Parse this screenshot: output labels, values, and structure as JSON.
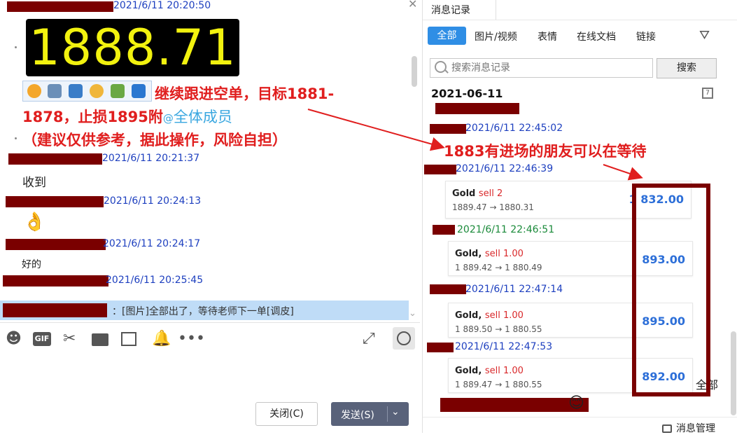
{
  "left": {
    "messages": [
      {
        "time": "2021/6/11 20:20:50"
      },
      {
        "time": "2021/6/11 20:21:37",
        "text": "收到"
      },
      {
        "time": "2021/6/11 20:24:13",
        "emoji": "👌"
      },
      {
        "time": "2021/6/11 20:24:17",
        "text": "好的"
      },
      {
        "time": "2021/6/11 20:25:45"
      }
    ],
    "price_display": "1888.71",
    "annotation_line1": "继续跟进空单，目标1881-",
    "annotation_line2": "1878，止损1895附",
    "mention_at": "@",
    "mention": "全体成员",
    "annotation_line3": "（建议仅供参考，据此操作，风险自担）",
    "notice_text": "：[图片]全部出了，等待老师下一单[调皮]",
    "close_button": "关闭(C)",
    "send_button": "发送(S)"
  },
  "right": {
    "tab_title": "消息记录",
    "filters": [
      "全部",
      "图片/视频",
      "表情",
      "在线文档",
      "链接"
    ],
    "search_placeholder": "搜索消息记录",
    "search_button": "搜索",
    "date_header": "2021-06-11",
    "calendar_day": "7",
    "times": [
      "2021/6/11 22:45:02",
      "2021/6/11 22:46:39",
      "2021/6/11 22:46:51",
      "2021/6/11 22:47:14",
      "2021/6/11 22:47:53"
    ],
    "trades": [
      {
        "symbol": "Gold",
        "side": "sell 2",
        "prices": "1889.47 → 1880.31",
        "profit": "1 832.00"
      },
      {
        "symbol": "Gold,",
        "side": "sell 1.00",
        "prices": "1 889.42 → 1 880.49",
        "profit": "893.00"
      },
      {
        "symbol": "Gold,",
        "side": "sell 1.00",
        "prices": "1 889.50 → 1 880.55",
        "profit": "895.00"
      },
      {
        "symbol": "Gold,",
        "side": "sell 1.00",
        "prices": "1 889.47 → 1 880.55",
        "profit": "892.00"
      }
    ],
    "all_label": "全部",
    "manage_label": "消息管理"
  },
  "overlay": {
    "annotation": "1883有进场的朋友可以在等待"
  },
  "colors": {
    "accent": "#2f8ee5",
    "annotation_red": "#e01e1e",
    "redaction": "#7a0000",
    "timestamp_blue": "#1d3fbf",
    "price_yellow": "#f2f20f"
  }
}
